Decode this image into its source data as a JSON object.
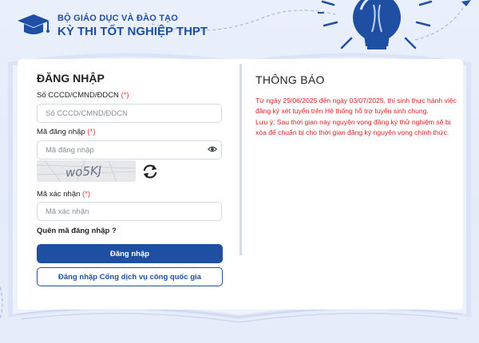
{
  "header": {
    "org": "BỘ GIÁO DỤC VÀ ĐÀO TẠO",
    "exam": "KỲ THI TỐT NGHIỆP THPT"
  },
  "login": {
    "title": "ĐĂNG NHẬP",
    "id_label": "Số CCCD/CMND/ĐDCN",
    "id_placeholder": "Số CCCD/CMND/ĐDCN",
    "code_label": "Mã đăng nhập",
    "code_placeholder": "Mã đăng nhập",
    "captcha_text": "wo5KJ",
    "confirm_label": "Mã xác nhận",
    "confirm_placeholder": "Mã xác nhận",
    "required_mark": "(*)",
    "forgot": "Quên mã đăng nhập ?",
    "login_button": "Đăng nhập",
    "portal_button": "Đăng nhập Cổng dịch vụ công quốc gia"
  },
  "notice": {
    "title": "THÔNG BÁO",
    "line1": "Từ ngày 29/06/2025 đến ngày 03/07/2025, thí sinh thực hành việc đăng ký xét tuyển trên Hệ thống hỗ trợ tuyển sinh chung.",
    "line2": "Lưu ý: Sau thời gian này nguyện vọng đăng ký thử nghiệm sẽ bị xóa để chuẩn bị cho thời gian đăng ký nguyện vọng chính thức."
  },
  "colors": {
    "brand": "#1f4fa3",
    "notice_text": "#e02020",
    "required": "#e53935",
    "background": "#e6edf9"
  },
  "icons": {
    "logo": "graduation-cap-icon",
    "show_password": "eye-icon",
    "refresh_captcha": "refresh-icon",
    "decoration": "lightbulb-icon"
  }
}
